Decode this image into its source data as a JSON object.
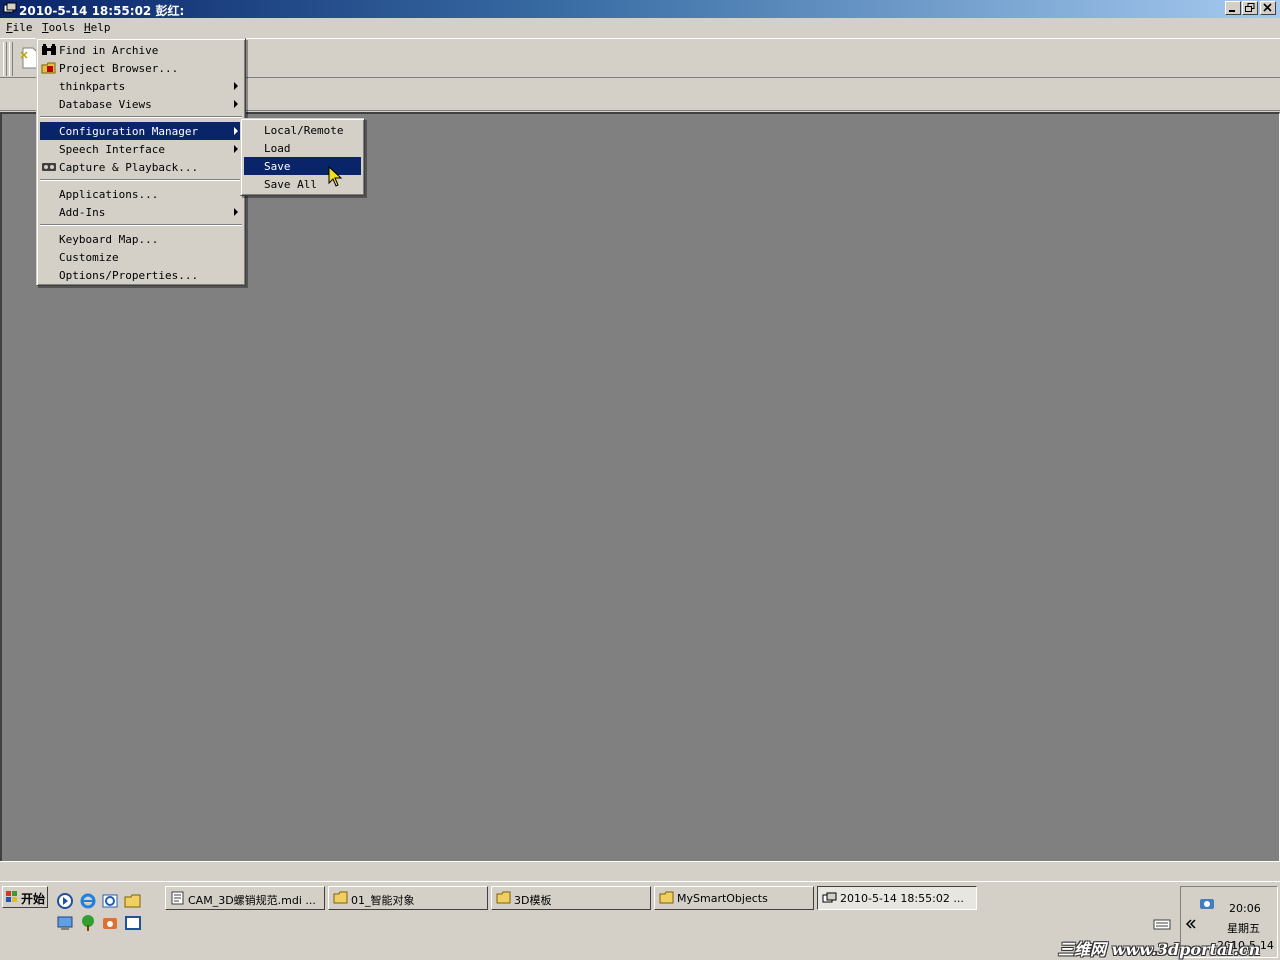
{
  "window": {
    "title": "2010-5-14 18:55:02 彭红:"
  },
  "menubar": {
    "file": "File",
    "tools": "Tools",
    "help": "Help"
  },
  "tools_menu": {
    "items": [
      {
        "label": "Find in Archive",
        "icon": "binoculars-icon"
      },
      {
        "label": "Project Browser...",
        "icon": "project-browser-icon"
      },
      {
        "label": "thinkparts",
        "submenu": true
      },
      {
        "label": "Database Views",
        "submenu": true
      },
      {
        "label": "Configuration Manager",
        "submenu": true,
        "highlighted": true
      },
      {
        "label": "Speech Interface",
        "submenu": true
      },
      {
        "label": "Capture & Playback...",
        "icon": "tape-icon"
      },
      {
        "label": "Applications..."
      },
      {
        "label": "Add-Ins",
        "submenu": true
      },
      {
        "label": "Keyboard Map..."
      },
      {
        "label": "Customize"
      },
      {
        "label": "Options/Properties..."
      }
    ]
  },
  "config_submenu": {
    "items": [
      {
        "label": "Local/Remote"
      },
      {
        "label": "Load"
      },
      {
        "label": "Save",
        "highlighted": true
      },
      {
        "label": "Save All"
      }
    ]
  },
  "taskbar": {
    "start_label": "开始",
    "tasks": [
      {
        "label": "CAM_3D螺销规范.mdi ..."
      },
      {
        "label": "01_智能对象"
      },
      {
        "label": "3D模板"
      },
      {
        "label": "MySmartObjects"
      },
      {
        "label": "2010-5-14 18:55:02 ..."
      }
    ],
    "tray": {
      "time": "20:06",
      "day": "星期五",
      "date": "2010-5-14"
    }
  },
  "watermark": "三维网 www.3dportal.cn",
  "colors": {
    "menu_highlight": "#0a246a",
    "face": "#d4d0c8",
    "mdi_background": "#808080"
  }
}
